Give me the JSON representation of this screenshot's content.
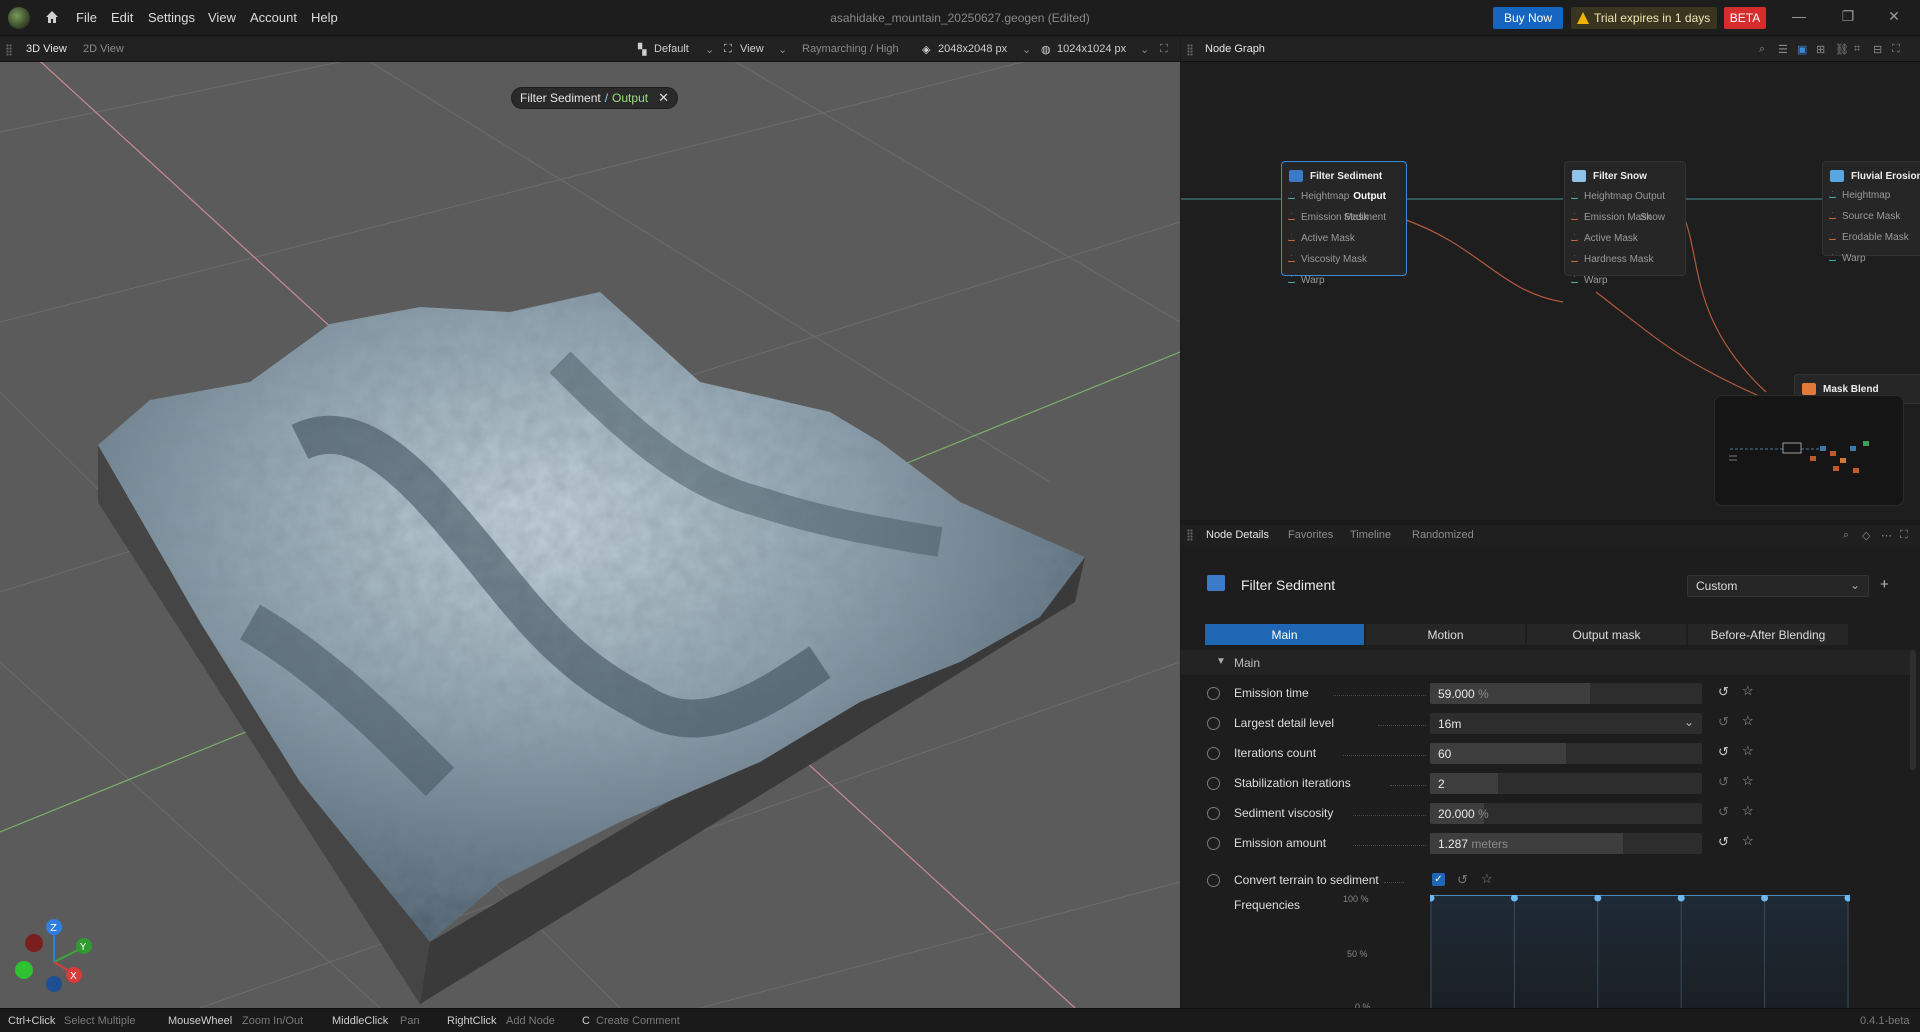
{
  "titlebar": {
    "menus": [
      "File",
      "Edit",
      "Settings",
      "View",
      "Account",
      "Help"
    ],
    "document_title": "asahidake_mountain_20250627.geogen",
    "edited_tag": "(Edited)",
    "buy_now": "Buy Now",
    "trial": "Trial expires in 1 days",
    "beta": "BETA"
  },
  "view_toolbar": {
    "tabs": [
      "3D View",
      "2D View"
    ],
    "camera": "Default",
    "view_menu": "View",
    "render_mode": "Raymarching / High",
    "resolution": "2048x2048 px",
    "preview_resolution": "1024x1024 px"
  },
  "viewport": {
    "chip_node": "Filter Sediment",
    "chip_sep": "/",
    "chip_output": "Output",
    "axes": {
      "z": "Z",
      "y": "Y",
      "x": "X"
    }
  },
  "graph": {
    "title": "Node Graph",
    "nodes": [
      {
        "title": "Filter Sediment",
        "inputs": [
          "Heightmap",
          "Emission Mask",
          "Active Mask",
          "Viscosity Mask",
          "Warp"
        ],
        "outputs": [
          "Output",
          "Sediment"
        ]
      },
      {
        "title": "Filter Snow",
        "inputs": [
          "Heightmap",
          "Emission Mask",
          "Active Mask",
          "Hardness Mask",
          "Warp"
        ],
        "outputs": [
          "Output",
          "Snow"
        ]
      },
      {
        "title": "Fluvial Erosion",
        "inputs": [
          "Heightmap",
          "Source Mask",
          "Erodable Mask",
          "Warp"
        ],
        "outputs": []
      },
      {
        "title": "Mask Blend",
        "inputs": [],
        "outputs": []
      }
    ]
  },
  "details": {
    "tabs": [
      "Node Details",
      "Favorites",
      "Timeline",
      "Randomized"
    ],
    "node_title": "Filter Sediment",
    "preset": "Custom",
    "sections": [
      "Main",
      "Motion",
      "Output mask",
      "Before-After Blending"
    ],
    "group": "Main",
    "params": [
      {
        "label": "Emission time",
        "value": "59.000",
        "unit": "%",
        "fill": 0.59,
        "type": "slider"
      },
      {
        "label": "Largest detail level",
        "value": "16m",
        "unit": "",
        "fill": 0,
        "type": "select"
      },
      {
        "label": "Iterations count",
        "value": "60",
        "unit": "",
        "fill": 0.5,
        "type": "slider"
      },
      {
        "label": "Stabilization iterations",
        "value": "2",
        "unit": "",
        "fill": 0.25,
        "type": "slider"
      },
      {
        "label": "Sediment viscosity",
        "value": "20.000",
        "unit": "%",
        "fill": 0.2,
        "type": "slider"
      },
      {
        "label": "Emission amount",
        "value": "1.287",
        "unit": "meters",
        "fill": 0.71,
        "type": "slider"
      }
    ],
    "checkbox_param": {
      "label": "Convert terrain to sediment",
      "checked": true
    },
    "frequencies": {
      "label": "Frequencies",
      "y_ticks": [
        "100 %",
        "50 %",
        "0 %"
      ],
      "points": [
        1,
        1,
        1,
        1,
        1,
        1
      ]
    }
  },
  "statusbar": {
    "hints": [
      {
        "key": "Ctrl+Click",
        "action": "Select Multiple"
      },
      {
        "key": "MouseWheel",
        "action": "Zoom In/Out"
      },
      {
        "key": "MiddleClick",
        "action": "Pan"
      },
      {
        "key": "RightClick",
        "action": "Add Node"
      },
      {
        "key": "C",
        "action": "Create Comment"
      }
    ],
    "version": "0.4.1-beta"
  },
  "colors": {
    "accent": "#1f67b5",
    "beta": "#d62c2c",
    "output_green": "#9be07a",
    "select_blue": "#3b8bd8"
  }
}
